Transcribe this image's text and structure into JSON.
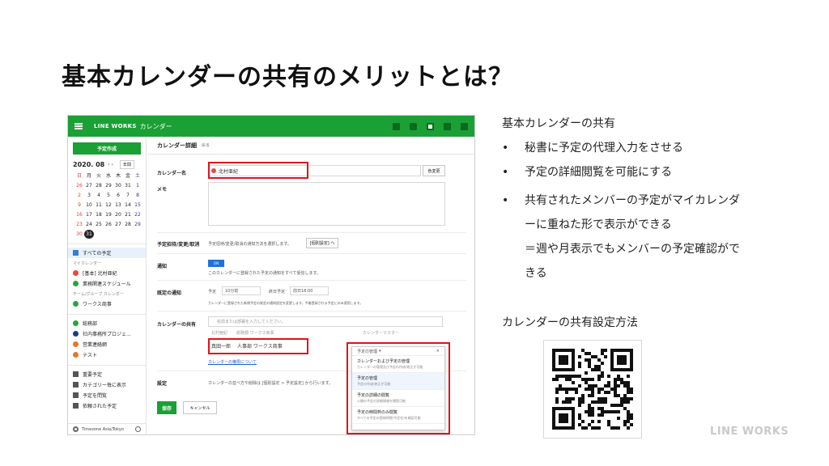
{
  "slide_title": "基本カレンダーの共有のメリットとは？",
  "app": {
    "brand": "LINE WORKS",
    "brand_sub": "カレンダー",
    "top_icons": [
      "home-icon",
      "chat-icon",
      "calendar-icon",
      "notes-icon",
      "mail-icon"
    ],
    "accent_color": "#1aa034"
  },
  "sidebar": {
    "create_button": "予定作成",
    "mini_calendar": {
      "month": "2020. 08",
      "year_button": "年間",
      "weekdays": [
        "日",
        "月",
        "火",
        "水",
        "木",
        "金",
        "土"
      ],
      "weeks": [
        [
          "26",
          "27",
          "28",
          "29",
          "30",
          "31",
          "1"
        ],
        [
          "2",
          "3",
          "4",
          "5",
          "6",
          "7",
          "8"
        ],
        [
          "9",
          "10",
          "11",
          "12",
          "13",
          "14",
          "15"
        ],
        [
          "16",
          "17",
          "18",
          "19",
          "20",
          "21",
          "22"
        ],
        [
          "23",
          "24",
          "25",
          "26",
          "27",
          "28",
          "29"
        ],
        [
          "30",
          "31",
          "",
          "",
          "",
          "",
          ""
        ]
      ],
      "today": "31"
    },
    "all_events": "すべての予定",
    "my_calendar_group": "マイカレンダー",
    "my_calendars": [
      {
        "label": "[基本] 北村亜紀",
        "color": "#e64a3c"
      },
      {
        "label": "業務関連スケジュール",
        "color": "#2aa53a"
      }
    ],
    "team_group": "チーム/グループ カレンダー",
    "team_calendars": [
      {
        "label": "ワークス商事",
        "color": "#2aa53a"
      }
    ],
    "other_calendars": [
      {
        "label": "総務部",
        "color": "#2aa53a"
      },
      {
        "label": "社内事務所プロジェ...",
        "color": "#1c3a8c"
      },
      {
        "label": "営業連絡網",
        "color": "#e8752a"
      },
      {
        "label": "テスト",
        "color": "#e8752a"
      }
    ],
    "tools": [
      "重要予定",
      "カテゴリー毎に表示",
      "予定を問覧",
      "依頼された予定"
    ],
    "footer_timezone": "Timezone Asia/Tokyo"
  },
  "detail": {
    "header": "カレンダー詳細",
    "back": "戻る",
    "name_label": "カレンダー名",
    "name_value": "北村亜紀",
    "change_color": "色変更",
    "memo_label": "メモ",
    "invite_label": "予定招待/変更/取消",
    "invite_text": "予定招待/変更/取消の通知方法を選択します。",
    "invite_button": "[個別設定] へ",
    "notice_label": "通知",
    "notice_toggle": "ON",
    "notice_text": "このカレンダーに登録された予定の通知をすべて受信します。",
    "default_notice_label": "既定の通知",
    "default_notice_items": [
      "予定",
      "10分前",
      "終日予定",
      "前日18:00"
    ],
    "default_notice_text": "カレンダーに登録された新規予定の既定の通知設定を変更します。今後登録される予定にのみ適用します。",
    "share_label": "カレンダーの共有",
    "share_placeholder": "名前または部署を入力してください。",
    "share_rows": [
      {
        "name": "北村亜紀",
        "dept": "総務部 ワークス商事",
        "perm": "カレンダーマスター"
      },
      {
        "name": "真田一郎",
        "dept": "人事部 ワークス商事",
        "perm": "予定の管理"
      }
    ],
    "share_link": "カレンダーの権限について",
    "settings_label": "設定",
    "settings_text": "カレンダーの並べ方や削除は [個別設定 > 予定設定] から行います。",
    "save": "保存",
    "cancel": "キャンセル"
  },
  "permission_popup": {
    "selected": "予定の管理",
    "options": [
      {
        "title": "カレンダーおよび予定の管理",
        "desc": "カレンダーの管理及び予定の作成/修正が可能"
      },
      {
        "title": "予定の管理",
        "desc": "予定の作成/修正が可能"
      },
      {
        "title": "予定の詳細の閲覧",
        "desc": "公開の予定の詳細情報を閲覧可能"
      },
      {
        "title": "予定の時間枠のみ閲覧",
        "desc": "すべての予定の登録時間(予定名)を確認可能"
      }
    ]
  },
  "right_panel": {
    "heading": "基本カレンダーの共有",
    "bullets": [
      "秘書に予定の代理入力をさせる",
      "予定の詳細閲覧を可能にする",
      "共有されたメンバーの予定がマイカレンダーに重ねた形で表示ができる"
    ],
    "bullet_note": "＝週や月表示でもメンバーの予定確認ができる",
    "method_heading": "カレンダーの共有設定方法"
  },
  "footer_logo": "LINE WORKS"
}
